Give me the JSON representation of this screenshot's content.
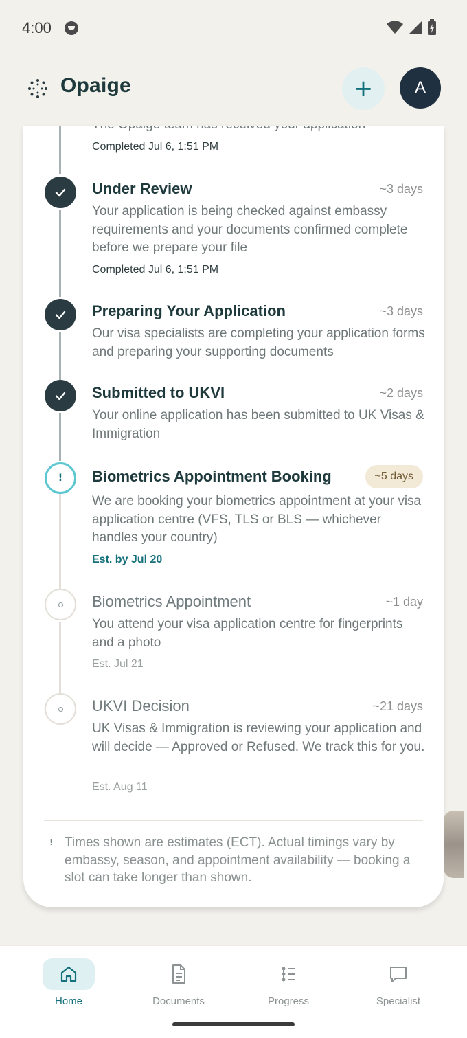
{
  "status_bar": {
    "time": "4:00"
  },
  "header": {
    "app_title": "Opaige",
    "add_label": "+",
    "avatar_initial": "A"
  },
  "timeline": {
    "partial_top_text": "The Opaige team has received your application",
    "partial_top_meta": "Completed Jul 6, 1:51 PM",
    "steps": [
      {
        "title": "Under Review",
        "duration": "~3 days",
        "description": "Your application is being checked against embassy requirements and your documents confirmed complete before we prepare your file",
        "meta": "Completed Jul 6, 1:51 PM",
        "state": "done"
      },
      {
        "title": "Preparing Your Application",
        "duration": "~3 days",
        "description": "Our visa specialists are completing your application forms and preparing your supporting documents",
        "meta": "",
        "state": "done"
      },
      {
        "title": "Submitted to UKVI",
        "duration": "~2 days",
        "description": "Your online application has been submitted to UK Visas & Immigration",
        "meta": "",
        "state": "done"
      },
      {
        "title": "Biometrics Appointment Booking",
        "duration": "~5 days",
        "description": "We are booking your biometrics appointment at your visa application centre (VFS, TLS or BLS — whichever handles your country)",
        "meta": "Est. by Jul 20",
        "state": "active",
        "marker_symbol": "!"
      },
      {
        "title": "Biometrics Appointment",
        "duration": "~1 day",
        "description": "You attend your visa application centre for fingerprints and a photo",
        "meta": "Est. Jul 21",
        "state": "pending"
      },
      {
        "title": "UKVI Decision",
        "duration": "~21 days",
        "description": "UK Visas & Immigration is reviewing your application and will decide — Approved or Refused. We track this for you.",
        "meta": "Est. Aug 11",
        "state": "pending"
      }
    ],
    "note_icon": "!",
    "note": "Times shown are estimates (ECT). Actual timings vary by embassy, season, and appointment availability — booking a slot can take longer than shown."
  },
  "bottom_nav": {
    "items": [
      {
        "label": "Home",
        "icon": "home-icon",
        "active": true
      },
      {
        "label": "Documents",
        "icon": "document-icon",
        "active": false
      },
      {
        "label": "Progress",
        "icon": "progress-list-icon",
        "active": false
      },
      {
        "label": "Specialist",
        "icon": "chat-icon",
        "active": false
      }
    ]
  },
  "colors": {
    "accent": "#14707a",
    "dark": "#2a3b41",
    "background": "#f3f1ec",
    "badge_bg": "#f2e9d7"
  }
}
